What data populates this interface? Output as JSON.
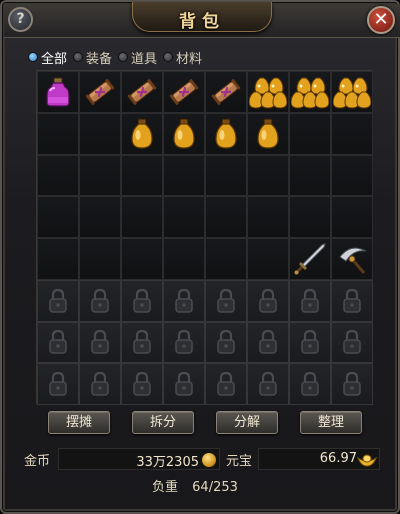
{
  "window": {
    "title": "背包"
  },
  "help_button": {
    "label": "?"
  },
  "close_button": {
    "label": "✕"
  },
  "tabs": [
    {
      "label": "全部",
      "active": true
    },
    {
      "label": "装备",
      "active": false
    },
    {
      "label": "道具",
      "active": false
    },
    {
      "label": "材料",
      "active": false
    }
  ],
  "inventory": {
    "columns": 8,
    "rows": [
      [
        "potion-icon",
        "scroll-icon",
        "scroll-icon",
        "scroll-icon",
        "scroll-icon",
        "elixir-bundle-icon",
        "elixir-bundle-icon",
        "elixir-bundle-icon"
      ],
      [
        "",
        "",
        "elixir-icon",
        "elixir-icon",
        "elixir-icon",
        "elixir-icon",
        "",
        ""
      ],
      [
        "",
        "",
        "",
        "",
        "",
        "",
        "",
        ""
      ],
      [
        "",
        "",
        "",
        "",
        "",
        "",
        "",
        ""
      ],
      [
        "",
        "",
        "",
        "",
        "",
        "",
        "sword-icon",
        "sickle-icon"
      ],
      [
        "lock-icon",
        "lock-icon",
        "lock-icon",
        "lock-icon",
        "lock-icon",
        "lock-icon",
        "lock-icon",
        "lock-icon"
      ],
      [
        "lock-icon",
        "lock-icon",
        "lock-icon",
        "lock-icon",
        "lock-icon",
        "lock-icon",
        "lock-icon",
        "lock-icon"
      ],
      [
        "lock-icon",
        "lock-icon",
        "lock-icon",
        "lock-icon",
        "lock-icon",
        "lock-icon",
        "lock-icon",
        "lock-icon"
      ]
    ]
  },
  "actions": {
    "stall": "摆摊",
    "split": "拆分",
    "decompose": "分解",
    "sort": "整理"
  },
  "currency": {
    "gold_label": "金币",
    "gold_value": "33万2305",
    "gold_icon": "gold-coin-icon",
    "yuanbao_label": "元宝",
    "yuanbao_value": "66.97",
    "yuanbao_icon": "yuanbao-icon"
  },
  "weight": {
    "label": "负重",
    "value": "64/253"
  },
  "colors": {
    "accent": "#f3d79a",
    "active_tab": "#2e7cc3",
    "close": "#c0392b"
  }
}
